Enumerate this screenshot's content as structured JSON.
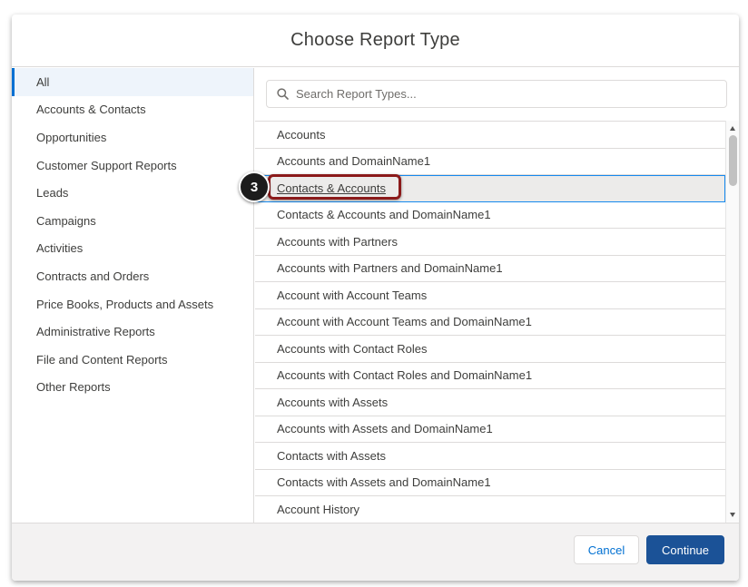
{
  "modal": {
    "title": "Choose Report Type"
  },
  "sidebar": {
    "items": [
      {
        "label": "All"
      },
      {
        "label": "Accounts & Contacts"
      },
      {
        "label": "Opportunities"
      },
      {
        "label": "Customer Support Reports"
      },
      {
        "label": "Leads"
      },
      {
        "label": "Campaigns"
      },
      {
        "label": "Activities"
      },
      {
        "label": "Contracts and Orders"
      },
      {
        "label": "Price Books, Products and Assets"
      },
      {
        "label": "Administrative Reports"
      },
      {
        "label": "File and Content Reports"
      },
      {
        "label": "Other Reports"
      }
    ],
    "active_item": "All"
  },
  "search": {
    "placeholder": "Search Report Types...",
    "value": ""
  },
  "report_types": {
    "items": [
      {
        "label": "Accounts"
      },
      {
        "label": "Accounts and DomainName1"
      },
      {
        "label": "Contacts & Accounts"
      },
      {
        "label": "Contacts & Accounts and DomainName1"
      },
      {
        "label": "Accounts with Partners"
      },
      {
        "label": "Accounts with Partners and DomainName1"
      },
      {
        "label": "Account with Account Teams"
      },
      {
        "label": "Account with Account Teams and DomainName1"
      },
      {
        "label": "Accounts with Contact Roles"
      },
      {
        "label": "Accounts with Contact Roles and DomainName1"
      },
      {
        "label": "Accounts with Assets"
      },
      {
        "label": "Accounts with Assets and DomainName1"
      },
      {
        "label": "Contacts with Assets"
      },
      {
        "label": "Contacts with Assets and DomainName1"
      },
      {
        "label": "Account History"
      }
    ],
    "selected_item": "Contacts & Accounts"
  },
  "footer": {
    "cancel_label": "Cancel",
    "continue_label": "Continue"
  },
  "callout": {
    "step_number": "3"
  },
  "colors": {
    "brand_blue": "#0070d2",
    "continue_button": "#1b5297",
    "callout_border": "#8b1a1a",
    "callout_badge": "#1c1c1c",
    "selection_outline": "#1589ee"
  }
}
